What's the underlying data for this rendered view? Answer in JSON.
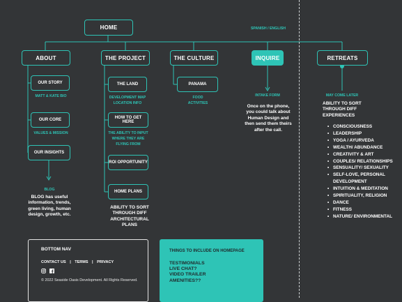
{
  "header": {
    "home": "HOME",
    "language": "SPANISH / ENGLISH"
  },
  "nav": {
    "about": "ABOUT",
    "project": "THE PROJECT",
    "culture": "THE CULTURE",
    "inquire": "INQUIRE",
    "retreats": "RETREATS"
  },
  "about": {
    "our_story": "OUR STORY",
    "our_story_note": "MATT & KATE BIO",
    "our_core": "OUR CORE",
    "our_core_note": "VALUES & MISSION",
    "our_insights": "OUR INSIGHTS",
    "blog_label": "BLOG",
    "blog_desc": "BLOG has useful information, trends, green living, human design, growth, etc."
  },
  "project": {
    "the_land": "THE LAND",
    "the_land_note_1": "DEVELOPMENT MAP",
    "the_land_note_2": "LOCATION INFO",
    "how_to_get_here": "HOW TO GET HERE",
    "how_note_1": "THE ABILITY TO INPUT",
    "how_note_2": "WHERE THEY ARE",
    "how_note_3": "FLYING FROM",
    "roi": "ROI OPPORTUNITY",
    "home_plans": "HOME PLANS",
    "home_plans_desc": "ABILITY TO SORT THROUGH DIFF ARCHITECTURAL PLANS"
  },
  "culture": {
    "panama": "PANAMA",
    "panama_note_1": "FOOD",
    "panama_note_2": "ACTIVITIES"
  },
  "inquire": {
    "note": "INTAKE FORM",
    "desc": "Once on the phone, you could talk about Human Design and then send them theirs after the call."
  },
  "retreats": {
    "note": "MAY COME LATER",
    "desc": "ABILITY TO SORT THROUGH DIFF EXPERIENCES",
    "items": [
      "CONSCIOUSNESS",
      "LEADERSHIP",
      "YOGA / AYURVEDA",
      "WEALTH/ ABUNDANCE",
      "CREATIVITY & ART",
      "COUPLES/ RELATIONSHIPS",
      "SENSUALITY/ SEXUALITY",
      "SELF-LOVE, PERSONAL DEVELOPMENT",
      "INTUITION & MEDITATION",
      "SPIRITUALITY, RELIGION",
      "DANCE",
      "FITNESS",
      "NATURE/ ENVIRONMENTAL"
    ]
  },
  "footer": {
    "title": "BOTTOM NAV",
    "contact": "CONTACT US",
    "terms": "TERMS",
    "privacy": "PRIVACY",
    "sep": "|",
    "copyright": "© 2022 Seaside Oasis Development. All Rights Reserved.",
    "icons": [
      "instagram-icon",
      "facebook-icon"
    ]
  },
  "homepage_panel": {
    "title": "THINGS TO INCLUDE ON HOMEPAGE",
    "items": [
      "TESTIMONIALS",
      "LIVE CHAT?",
      "VIDEO TRAILER",
      "AMENITIES??"
    ]
  },
  "colors": {
    "background": "#333537",
    "accent": "#2ec4b6",
    "text": "#ffffff"
  }
}
